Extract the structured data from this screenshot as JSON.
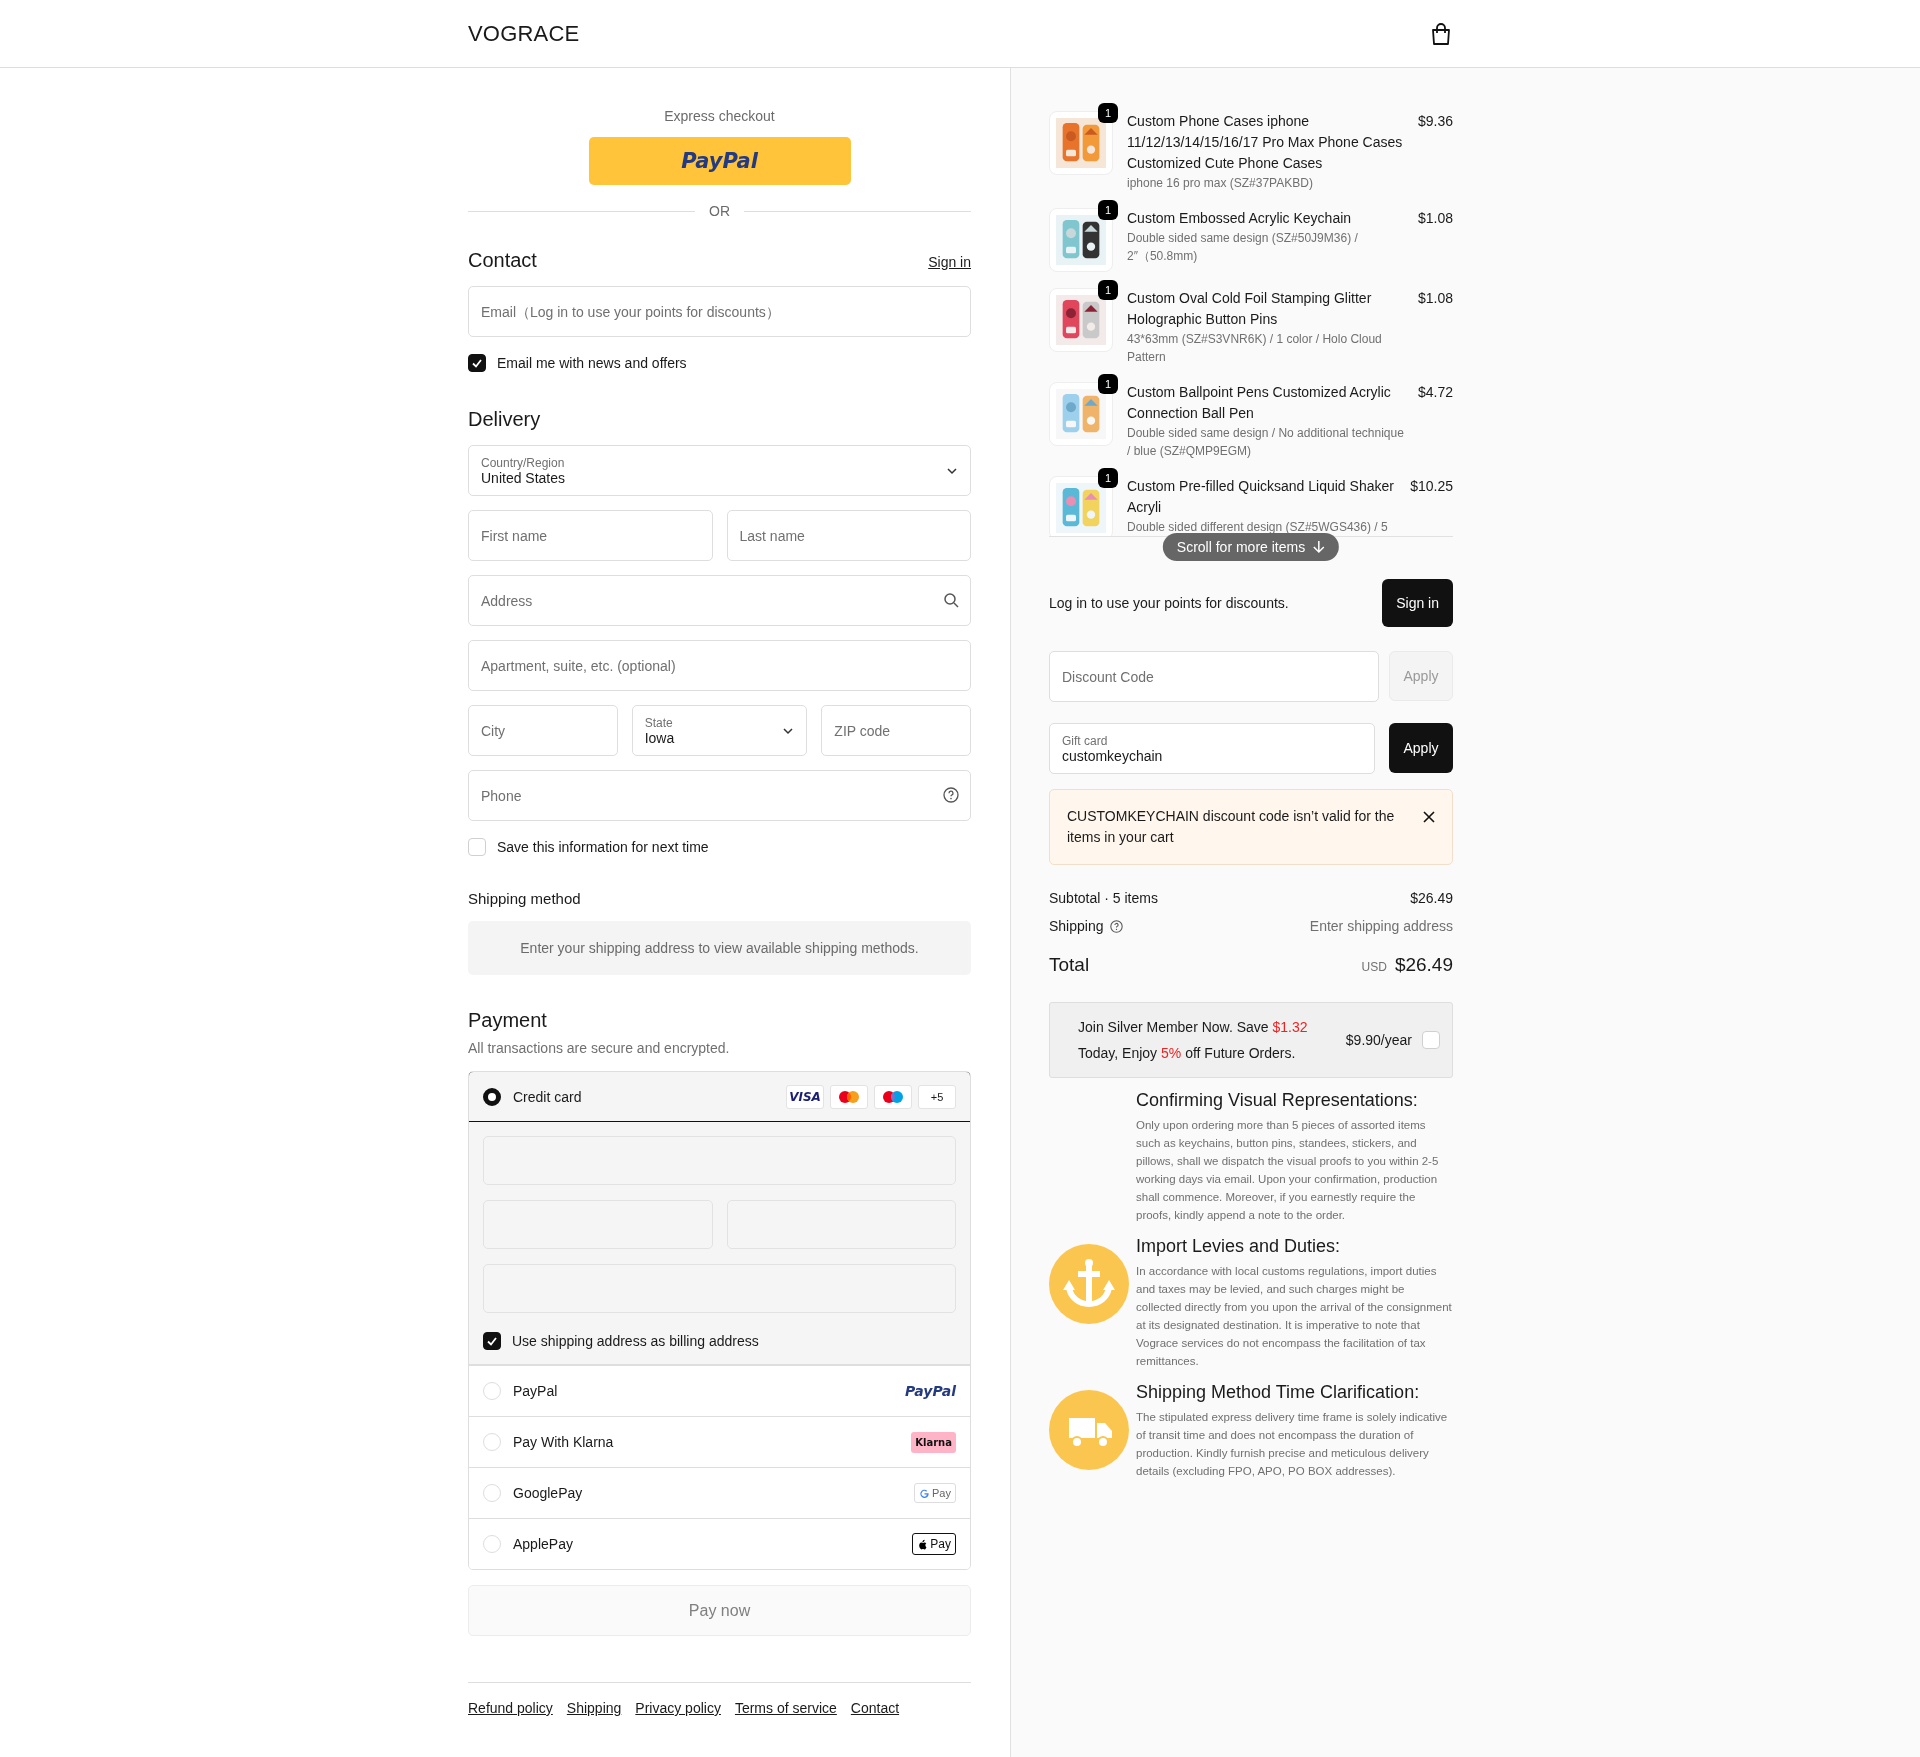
{
  "header": {
    "logo": "VOGRACE"
  },
  "express_checkout": {
    "label": "Express checkout",
    "button": "PayPal",
    "divider": "OR"
  },
  "contact": {
    "title": "Contact",
    "sign_in": "Sign in",
    "email": {
      "placeholder": "Email（Log in to use your points for discounts）"
    },
    "news": {
      "label": "Email me with news and offers",
      "checked": true
    }
  },
  "delivery": {
    "title": "Delivery",
    "rows": [
      [
        {
          "kind": "select",
          "label": "Country/Region",
          "value": "United States"
        }
      ],
      [
        {
          "kind": "text",
          "placeholder": "First name"
        },
        {
          "kind": "text",
          "placeholder": "Last name"
        }
      ],
      [
        {
          "kind": "search",
          "placeholder": "Address"
        }
      ],
      [
        {
          "kind": "text",
          "placeholder": "Apartment, suite, etc. (optional)"
        }
      ],
      [
        {
          "kind": "text",
          "placeholder": "City"
        },
        {
          "kind": "select",
          "label": "State",
          "value": "Iowa"
        },
        {
          "kind": "text",
          "placeholder": "ZIP code"
        }
      ],
      [
        {
          "kind": "help",
          "placeholder": "Phone"
        }
      ]
    ],
    "save": {
      "label": "Save this information for next time",
      "checked": false
    }
  },
  "shipping_method": {
    "title": "Shipping method",
    "message": "Enter your shipping address to view available shipping methods."
  },
  "payment": {
    "title": "Payment",
    "subtitle": "All transactions are secure and encrypted.",
    "methods": [
      {
        "kind": "card",
        "label": "Credit card",
        "selected": true,
        "badges": [
          {
            "kind": "visa",
            "text": "VISA"
          },
          {
            "kind": "mastercard"
          },
          {
            "kind": "maestro"
          },
          {
            "kind": "more",
            "text": "+5"
          }
        ]
      },
      {
        "kind": "paypal",
        "label": "PayPal",
        "selected": false,
        "logo_text": "PayPal"
      },
      {
        "kind": "klarna",
        "label": "Pay With Klarna",
        "selected": false,
        "logo_text": "Klarna"
      },
      {
        "kind": "googlepay",
        "label": "GooglePay",
        "selected": false,
        "logo_text": "Pay"
      },
      {
        "kind": "applepay",
        "label": "ApplePay",
        "selected": false,
        "logo_text": "Pay"
      }
    ],
    "billing": {
      "label": "Use shipping address as billing address",
      "checked": true
    },
    "pay_button": {
      "label": "Pay now",
      "disabled": true
    }
  },
  "footer": {
    "links": [
      "Refund policy",
      "Shipping",
      "Privacy policy",
      "Terms of service",
      "Contact"
    ]
  },
  "cart": {
    "items": [
      {
        "title": "Custom Phone Cases iphone 11/12/13/14/15/16/17 Pro Max Phone Cases Customized Cute Phone Cases",
        "variant": "iphone 16 pro max (SZ#37PAKBD)",
        "price": "$9.36",
        "quantity": "1"
      },
      {
        "title": "Custom Embossed Acrylic Keychain",
        "variant": "Double sided same design (SZ#50J9M36) / 2″（50.8mm)",
        "price": "$1.08",
        "quantity": "1"
      },
      {
        "title": "Custom Oval Cold Foil Stamping Glitter Holographic Button Pins",
        "variant": "43*63mm (SZ#S3VNR6K) / 1 color / Holo Cloud Pattern",
        "price": "$1.08",
        "quantity": "1"
      },
      {
        "title": "Custom Ballpoint Pens Customized Acrylic Connection Ball Pen",
        "variant": "Double sided same design / No additional technique / blue (SZ#QMP9EGM)",
        "price": "$4.72",
        "quantity": "1"
      },
      {
        "title": "Custom Pre-filled Quicksand Liquid Shaker Acryli",
        "variant": "Double sided different design (SZ#5WGS436) / 5",
        "price": "$10.25",
        "quantity": "1"
      }
    ],
    "scroll_hint": "Scroll for more items"
  },
  "login_prompt": {
    "text": "Log in to use your points for discounts.",
    "button": "Sign in"
  },
  "discount": {
    "placeholder": "Discount Code",
    "button": "Apply",
    "disabled": true
  },
  "gift_card": {
    "label": "Gift card",
    "value": "customkeychain",
    "button": "Apply",
    "disabled": false
  },
  "error": {
    "message": "CUSTOMKEYCHAIN discount code isn’t valid for the items in your cart"
  },
  "summary": {
    "subtotal_label": "Subtotal · 5 items",
    "subtotal": "$26.49",
    "shipping_label": "Shipping",
    "shipping": "Enter shipping address",
    "total_label": "Total",
    "currency": "USD",
    "total": "$26.49"
  },
  "membership": {
    "segments": [
      {
        "text": "Join Silver Member Now. Save ",
        "highlight": false
      },
      {
        "text": "$1.32",
        "highlight": true
      },
      {
        "text": " Today, Enjoy ",
        "highlight": false
      },
      {
        "text": "5%",
        "highlight": true
      },
      {
        "text": " off Future Orders.",
        "highlight": false
      }
    ],
    "price": "$9.90/year",
    "checked": false
  },
  "info": [
    {
      "kind": "plain",
      "title": "Confirming Visual Representations:",
      "body": "Only upon ordering more than 5 pieces of assorted items such as keychains, button pins, standees, stickers, and pillows, shall we dispatch the visual proofs to you within 2-5 working days via email. Upon your confirmation, production shall commence. Moreover, if you earnestly require the proofs, kindly append a note to the order."
    },
    {
      "kind": "anchor",
      "title": "Import Levies and Duties:",
      "body": "In accordance with local customs regulations, import duties and taxes may be levied, and such charges might be collected directly from you upon the arrival of the consignment at its designated destination. It is imperative to note that Vograce services do not encompass the facilitation of tax remittances."
    },
    {
      "kind": "truck",
      "title": "Shipping Method Time Clarification:",
      "body": "The stipulated express delivery time frame is solely indicative of transit time and does not encompass the duration of production. Kindly furnish precise and meticulous delivery details (excluding FPO, APO, PO BOX addresses)."
    }
  ]
}
